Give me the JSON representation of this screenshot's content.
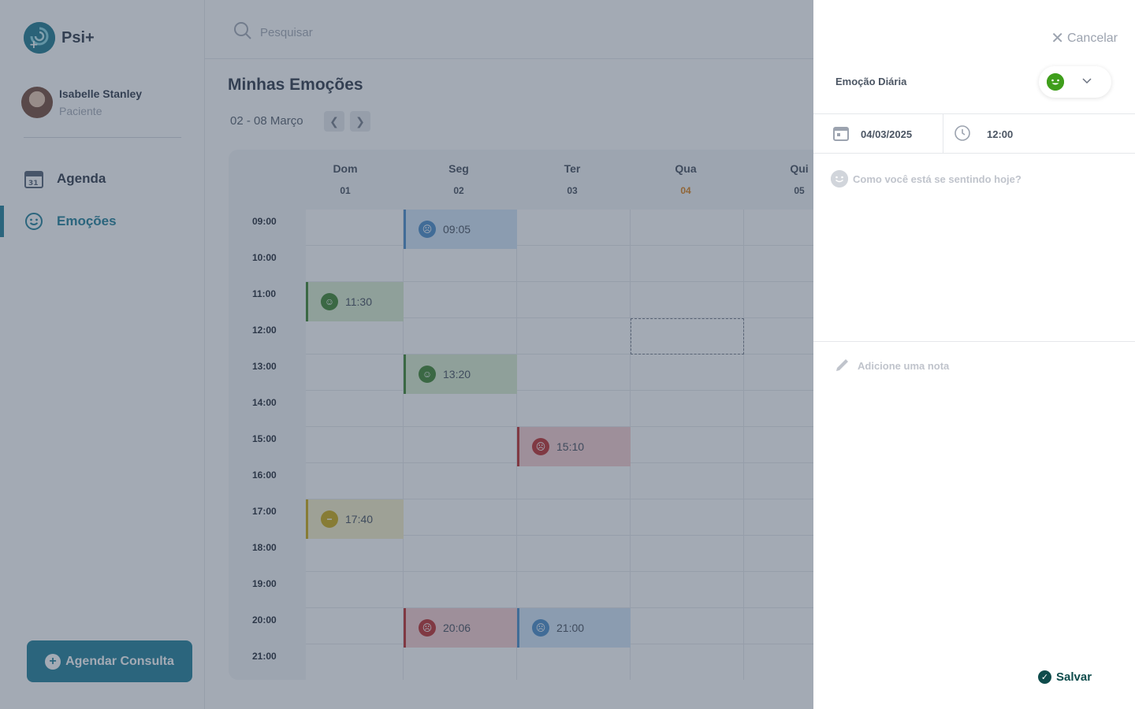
{
  "app": {
    "name": "Psi+"
  },
  "user": {
    "name": "Isabelle Stanley",
    "role": "Paciente"
  },
  "nav": [
    {
      "label": "Agenda",
      "icon": "calendar-icon",
      "active": false
    },
    {
      "label": "Emoções",
      "icon": "smile-icon",
      "active": true
    }
  ],
  "cta": {
    "label": "Agendar Consulta"
  },
  "search": {
    "placeholder": "Pesquisar"
  },
  "main": {
    "title": "Minhas Emoções",
    "range": "02 - 08  Março"
  },
  "calendar": {
    "days": [
      {
        "name": "Dom",
        "num": "01"
      },
      {
        "name": "Seg",
        "num": "02"
      },
      {
        "name": "Ter",
        "num": "03"
      },
      {
        "name": "Qua",
        "num": "04",
        "today": true
      },
      {
        "name": "Qui",
        "num": "05"
      }
    ],
    "hours": [
      "09:00",
      "10:00",
      "11:00",
      "12:00",
      "13:00",
      "14:00",
      "15:00",
      "16:00",
      "17:00",
      "18:00",
      "19:00",
      "20:00",
      "21:00"
    ],
    "events": [
      {
        "day": 1,
        "hour": 0,
        "time": "09:05",
        "mood": "sad"
      },
      {
        "day": 0,
        "hour": 2,
        "time": "11:30",
        "mood": "happy"
      },
      {
        "day": 1,
        "hour": 4,
        "time": "13:20",
        "mood": "happy"
      },
      {
        "day": 2,
        "hour": 6,
        "time": "15:10",
        "mood": "angry"
      },
      {
        "day": 0,
        "hour": 8,
        "time": "17:40",
        "mood": "neutral"
      },
      {
        "day": 1,
        "hour": 11,
        "time": "20:06",
        "mood": "angry"
      },
      {
        "day": 2,
        "hour": 11,
        "time": "21:00",
        "mood": "sad"
      }
    ],
    "selected": {
      "day": 3,
      "hour": 3
    }
  },
  "drawer": {
    "cancel_label": "Cancelar",
    "emotion_label": "Emoção Diária",
    "emotion_value": "happy",
    "date": "04/03/2025",
    "time": "12:00",
    "feeling_placeholder": "Como você está se sentindo hoje?",
    "note_placeholder": "Adicione uma nota",
    "save_label": "Salvar"
  },
  "colors": {
    "accent": "#0e7490",
    "happy": "#2f7a1f",
    "sad": "#3b82c4",
    "angry": "#b91c1c",
    "neutral": "#c7a300",
    "today": "#d97706"
  }
}
